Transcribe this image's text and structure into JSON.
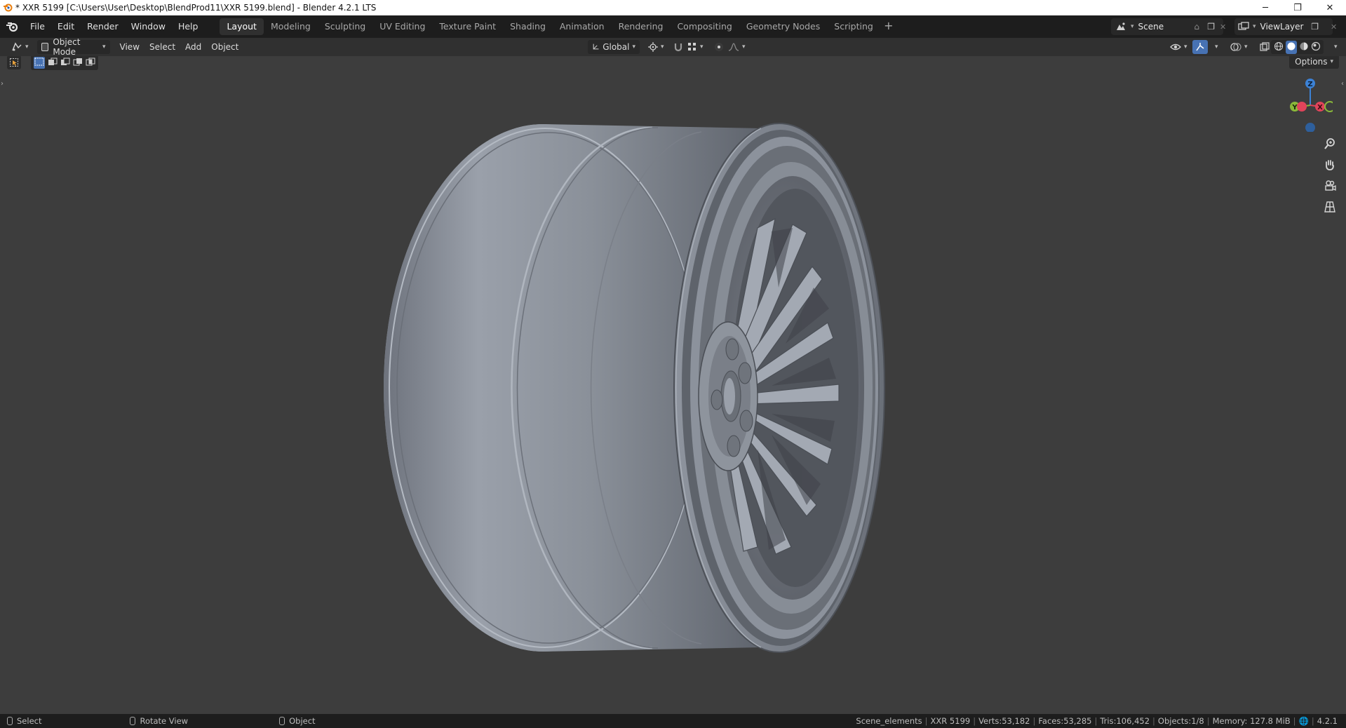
{
  "window": {
    "title": "* XXR 5199 [C:\\Users\\User\\Desktop\\BlendProd11\\XXR 5199.blend] - Blender 4.2.1 LTS"
  },
  "topbar": {
    "menus": [
      "File",
      "Edit",
      "Render",
      "Window",
      "Help"
    ],
    "workspaces": [
      "Layout",
      "Modeling",
      "Sculpting",
      "UV Editing",
      "Texture Paint",
      "Shading",
      "Animation",
      "Rendering",
      "Compositing",
      "Geometry Nodes",
      "Scripting"
    ],
    "active_workspace": "Layout",
    "scene": "Scene",
    "view_layer": "ViewLayer"
  },
  "viewport_header": {
    "mode": "Object Mode",
    "menus": [
      "View",
      "Select",
      "Add",
      "Object"
    ],
    "transform_orientation": "Global"
  },
  "viewport": {
    "options_label": "Options",
    "gizmo_axes": {
      "z": "Z",
      "y": "Y",
      "x": "X"
    }
  },
  "statusbar": {
    "left": [
      {
        "label": "Select"
      },
      {
        "label": "Rotate View"
      },
      {
        "label": "Object"
      }
    ],
    "stats": {
      "collection": "Scene_elements",
      "object": "XXR 5199",
      "verts": "Verts:53,182",
      "faces": "Faces:53,285",
      "tris": "Tris:106,452",
      "objects": "Objects:1/8",
      "memory": "Memory: 127.8 MiB",
      "version": "4.2.1"
    }
  },
  "colors": {
    "accent_blue": "#4772b3",
    "axis_x": "#e0445a",
    "axis_y": "#8ab83a",
    "axis_z": "#3c82d6"
  }
}
